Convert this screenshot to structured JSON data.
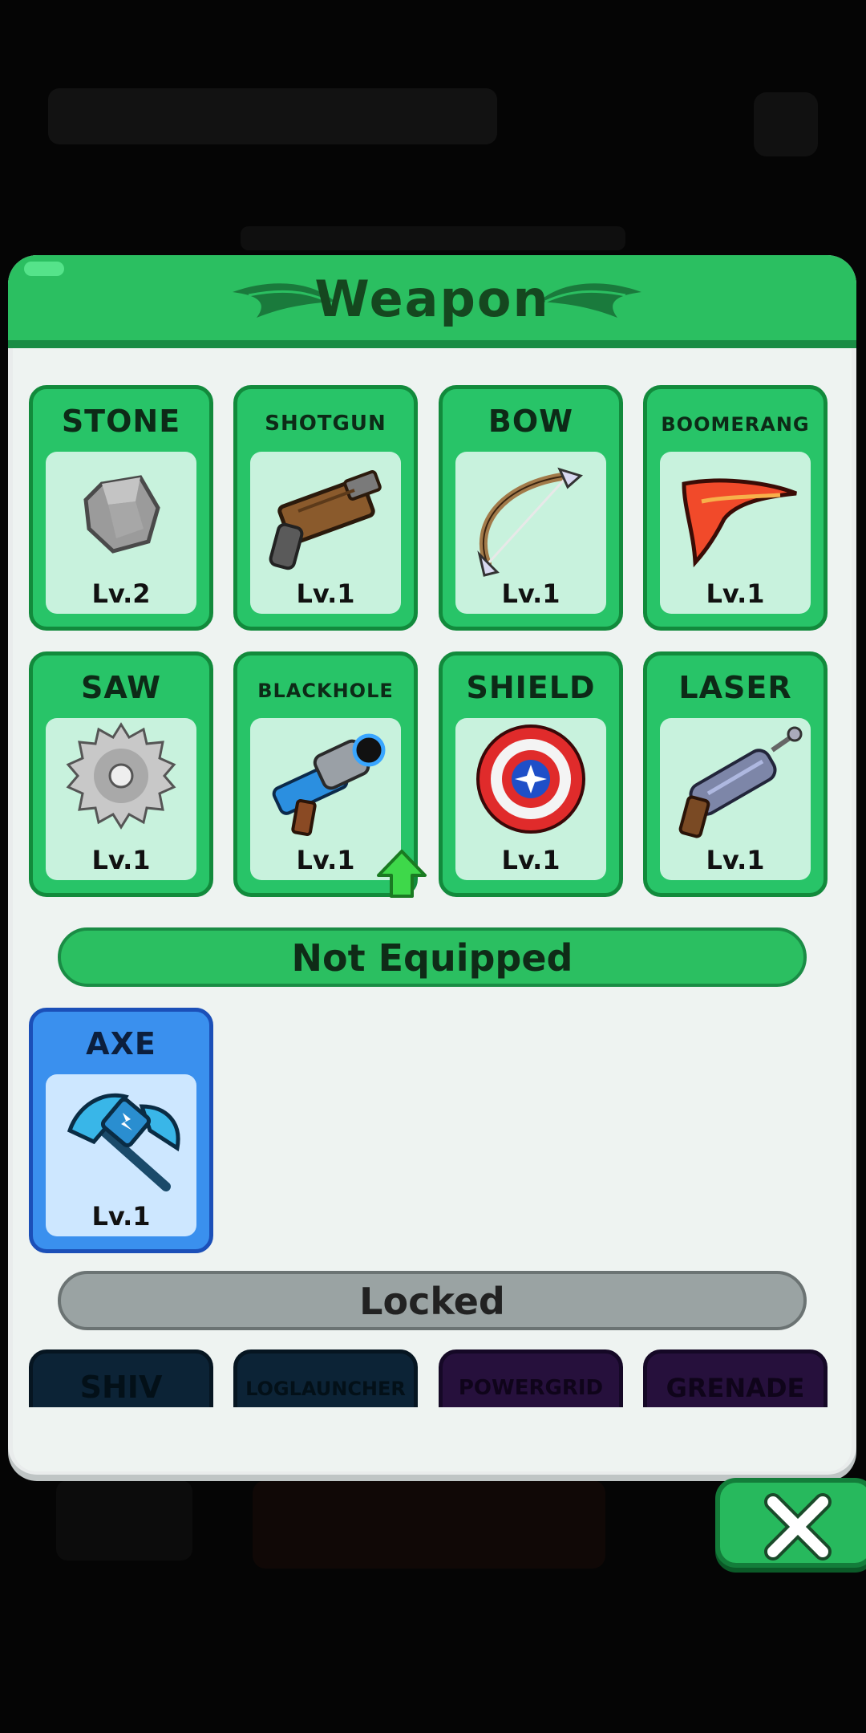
{
  "panel": {
    "title": "Weapon",
    "accent_color": "#2bbf61"
  },
  "equipped": [
    {
      "name": "STONE",
      "level": "Lv.2",
      "icon": "stone-icon"
    },
    {
      "name": "SHOTGUN",
      "level": "Lv.1",
      "icon": "shotgun-icon"
    },
    {
      "name": "BOW",
      "level": "Lv.1",
      "icon": "bow-icon"
    },
    {
      "name": "BOOMERANG",
      "level": "Lv.1",
      "icon": "boomerang-icon"
    },
    {
      "name": "SAW",
      "level": "Lv.1",
      "icon": "saw-blade-icon"
    },
    {
      "name": "BLACKHOLE",
      "level": "Lv.1",
      "icon": "blackhole-gun-icon",
      "upgrade_available": true
    },
    {
      "name": "SHIELD",
      "level": "Lv.1",
      "icon": "shield-icon"
    },
    {
      "name": "LASER",
      "level": "Lv.1",
      "icon": "laser-gun-icon"
    }
  ],
  "not_equipped_label": "Not Equipped",
  "not_equipped": [
    {
      "name": "AXE",
      "level": "Lv.1",
      "icon": "axe-icon"
    }
  ],
  "locked_label": "Locked",
  "locked": [
    {
      "name": "SHIV",
      "color": "#0c2336"
    },
    {
      "name": "LOGLAUNCHER",
      "color": "#0c2336"
    },
    {
      "name": "POWERGRID",
      "color": "#26103c"
    },
    {
      "name": "GRENADE",
      "color": "#26103c"
    }
  ],
  "close_icon": "close-icon"
}
